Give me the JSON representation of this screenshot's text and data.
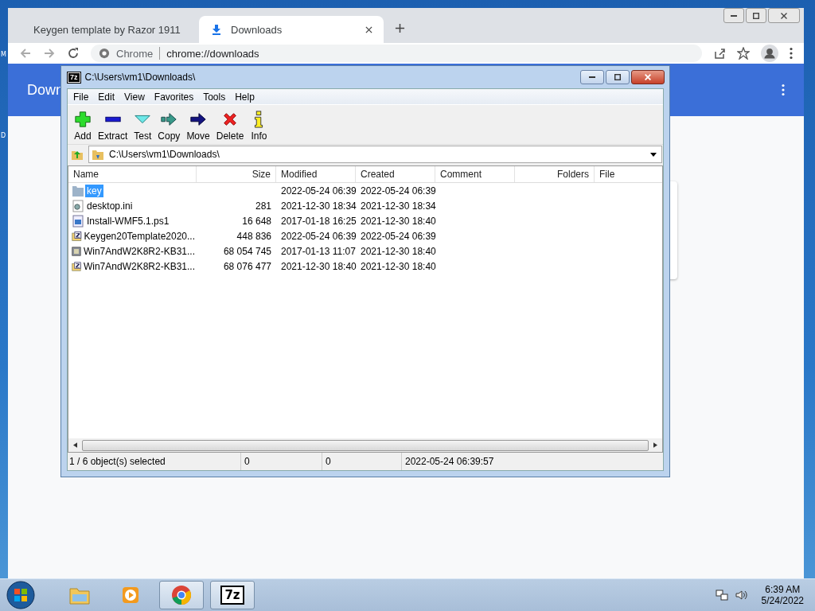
{
  "desktop": {
    "labels": [
      "M",
      "D"
    ]
  },
  "browser": {
    "tabs": [
      {
        "title": "Keygen template by Razor 1911",
        "selected": false,
        "kind": "page"
      },
      {
        "title": "Downloads",
        "selected": true,
        "kind": "download"
      }
    ],
    "omnibox": {
      "site": "Chrome",
      "url": "chrome://downloads"
    },
    "page": {
      "header": "Down"
    }
  },
  "archiver": {
    "icon_text": "7z",
    "title": "C:\\Users\\vm1\\Downloads\\",
    "menu": [
      "File",
      "Edit",
      "View",
      "Favorites",
      "Tools",
      "Help"
    ],
    "toolbar": [
      {
        "label": "Add",
        "kind": "add"
      },
      {
        "label": "Extract",
        "kind": "extract"
      },
      {
        "label": "Test",
        "kind": "test"
      },
      {
        "label": "Copy",
        "kind": "copy"
      },
      {
        "label": "Move",
        "kind": "move"
      },
      {
        "label": "Delete",
        "kind": "delete"
      },
      {
        "label": "Info",
        "kind": "info"
      }
    ],
    "path": "C:\\Users\\vm1\\Downloads\\",
    "columns": [
      "Name",
      "Size",
      "Modified",
      "Created",
      "Comment",
      "Folders",
      "File"
    ],
    "rows": [
      {
        "name": "key",
        "kind": "folder",
        "size": "",
        "modified": "2022-05-24 06:39",
        "created": "2022-05-24 06:39",
        "selected": true
      },
      {
        "name": "desktop.ini",
        "kind": "settings",
        "size": "281",
        "modified": "2021-12-30 18:34",
        "created": "2021-12-30 18:34",
        "selected": false
      },
      {
        "name": "Install-WMF5.1.ps1",
        "kind": "script",
        "size": "16 648",
        "modified": "2017-01-18 16:25",
        "created": "2021-12-30 18:40",
        "selected": false
      },
      {
        "name": "Keygen20Template2020...",
        "kind": "archive",
        "size": "448 836",
        "modified": "2022-05-24 06:39",
        "created": "2022-05-24 06:39",
        "selected": false
      },
      {
        "name": "Win7AndW2K8R2-KB31...",
        "kind": "package",
        "size": "68 054 745",
        "modified": "2017-01-13 11:07",
        "created": "2021-12-30 18:40",
        "selected": false
      },
      {
        "name": "Win7AndW2K8R2-KB31...",
        "kind": "archive",
        "size": "68 076 477",
        "modified": "2021-12-30 18:40",
        "created": "2021-12-30 18:40",
        "selected": false
      }
    ],
    "status_bar": [
      "1 / 6 object(s) selected",
      "0",
      "0",
      "2022-05-24 06:39:57"
    ]
  },
  "taskbar": {
    "apps": [
      {
        "kind": "explorer",
        "running": false
      },
      {
        "kind": "media",
        "running": false
      },
      {
        "kind": "chrome",
        "running": true
      },
      {
        "kind": "archiver",
        "running": true,
        "icon_text": "7z"
      }
    ],
    "time": "6:39 AM",
    "date": "5/24/2022"
  }
}
